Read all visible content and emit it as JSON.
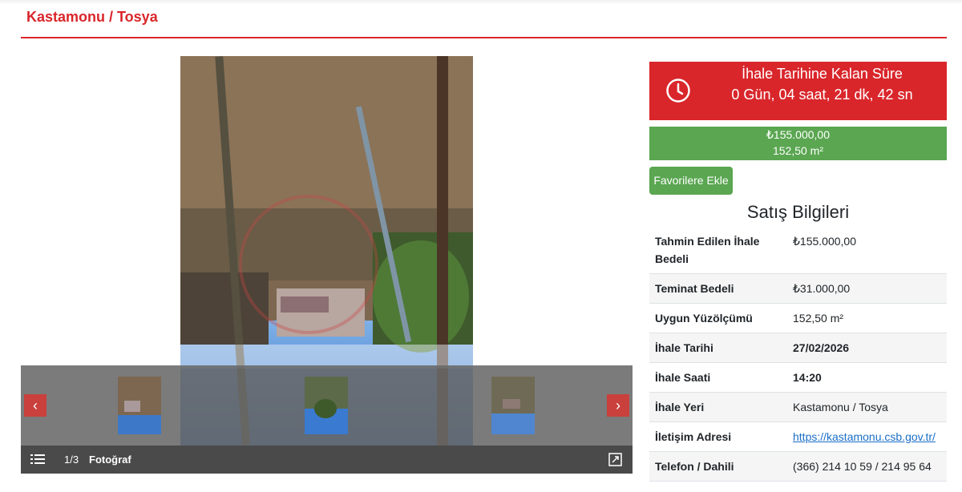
{
  "header": {
    "title": "Kastamonu / Tosya"
  },
  "gallery": {
    "counter": "1/3",
    "label": "Fotoğraf",
    "prev_icon": "chevron-left-icon",
    "next_icon": "chevron-right-icon",
    "list_icon": "list-icon",
    "expand_icon": "expand-icon"
  },
  "countdown": {
    "title": "İhale Tarihine Kalan Süre",
    "value": "0 Gün, 04 saat, 21 dk, 42 sn",
    "icon": "clock-icon"
  },
  "price": {
    "amount": "₺155.000,00",
    "area": "152,50 m²"
  },
  "favorite_button": "Favorilere Ekle",
  "section_title": "Satış Bilgileri",
  "info_rows": [
    {
      "label": "Tahmin Edilen İhale Bedeli",
      "value": "₺155.000,00"
    },
    {
      "label": "Teminat Bedeli",
      "value": "₺31.000,00"
    },
    {
      "label": "Uygun Yüzölçümü",
      "value": "152,50 m²"
    },
    {
      "label": "İhale Tarihi",
      "value": "27/02/2026"
    },
    {
      "label": "İhale Saati",
      "value": "14:20"
    },
    {
      "label": "İhale Yeri",
      "value": "Kastamonu / Tosya"
    },
    {
      "label": "İletişim Adresi",
      "value": "https://kastamonu.csb.gov.tr/"
    },
    {
      "label": "Telefon / Dahili",
      "value": "(366) 214 10 59 / 214 95 64"
    }
  ],
  "colors": {
    "accent_red": "#d9262b",
    "accent_green": "#5aa651",
    "link": "#1a6ec6"
  }
}
